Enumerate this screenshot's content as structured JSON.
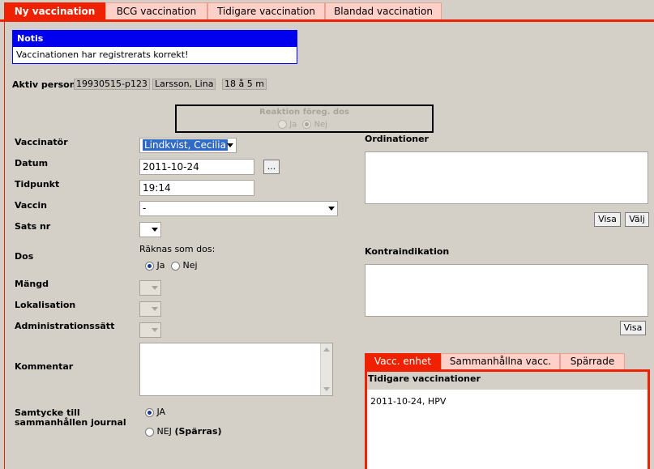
{
  "tabs": [
    "Ny vaccination",
    "BCG vaccination",
    "Tidigare vaccination",
    "Blandad vaccination"
  ],
  "notice": {
    "title": "Notis",
    "text": "Vaccinationen har registrerats korrekt!"
  },
  "active_person": {
    "label": "Aktiv person",
    "id": "19930515-p123",
    "name": "Larsson, Lina",
    "age": "18 å 5 m"
  },
  "reaction": {
    "title": "Reaktion föreg. dos",
    "yes": "Ja",
    "no": "Nej",
    "selected": "Nej"
  },
  "form": {
    "vaccinator_label": "Vaccinatör",
    "vaccinator_value": "Lindkvist, Cecilia",
    "date_label": "Datum",
    "date_value": "2011-10-24",
    "date_button": "...",
    "time_label": "Tidpunkt",
    "time_value": "19:14",
    "vaccine_label": "Vaccin",
    "vaccine_value": "-",
    "batch_label": "Sats nr",
    "dose_label": "Dos",
    "dose_question": "Räknas som dos:",
    "dose_yes": "Ja",
    "dose_no": "Nej",
    "dose_selected": "Ja",
    "amount_label": "Mängd",
    "location_label": "Lokalisation",
    "admin_label": "Administrationssätt",
    "comment_label": "Kommentar",
    "consent_label_line1": "Samtycke till",
    "consent_label_line2": "sammanhållen journal",
    "consent_yes": "JA",
    "consent_no": "NEJ",
    "consent_no_note": "(Spärras)",
    "consent_selected": "JA"
  },
  "right": {
    "orders_label": "Ordinationer",
    "show_button": "Visa",
    "choose_button": "Välj",
    "contra_label": "Kontraindikation",
    "contra_show_button": "Visa"
  },
  "subtabs": [
    "Vacc. enhet",
    "Sammanhållna vacc.",
    "Spärrade"
  ],
  "history": {
    "title": "Tidigare vaccinationer",
    "items": [
      "2011-10-24, HPV"
    ]
  },
  "colors": {
    "accent": "#ee2200",
    "notice": "#0000ee",
    "background": "#d4d0c8",
    "tab_inactive": "#ffd0c8"
  }
}
